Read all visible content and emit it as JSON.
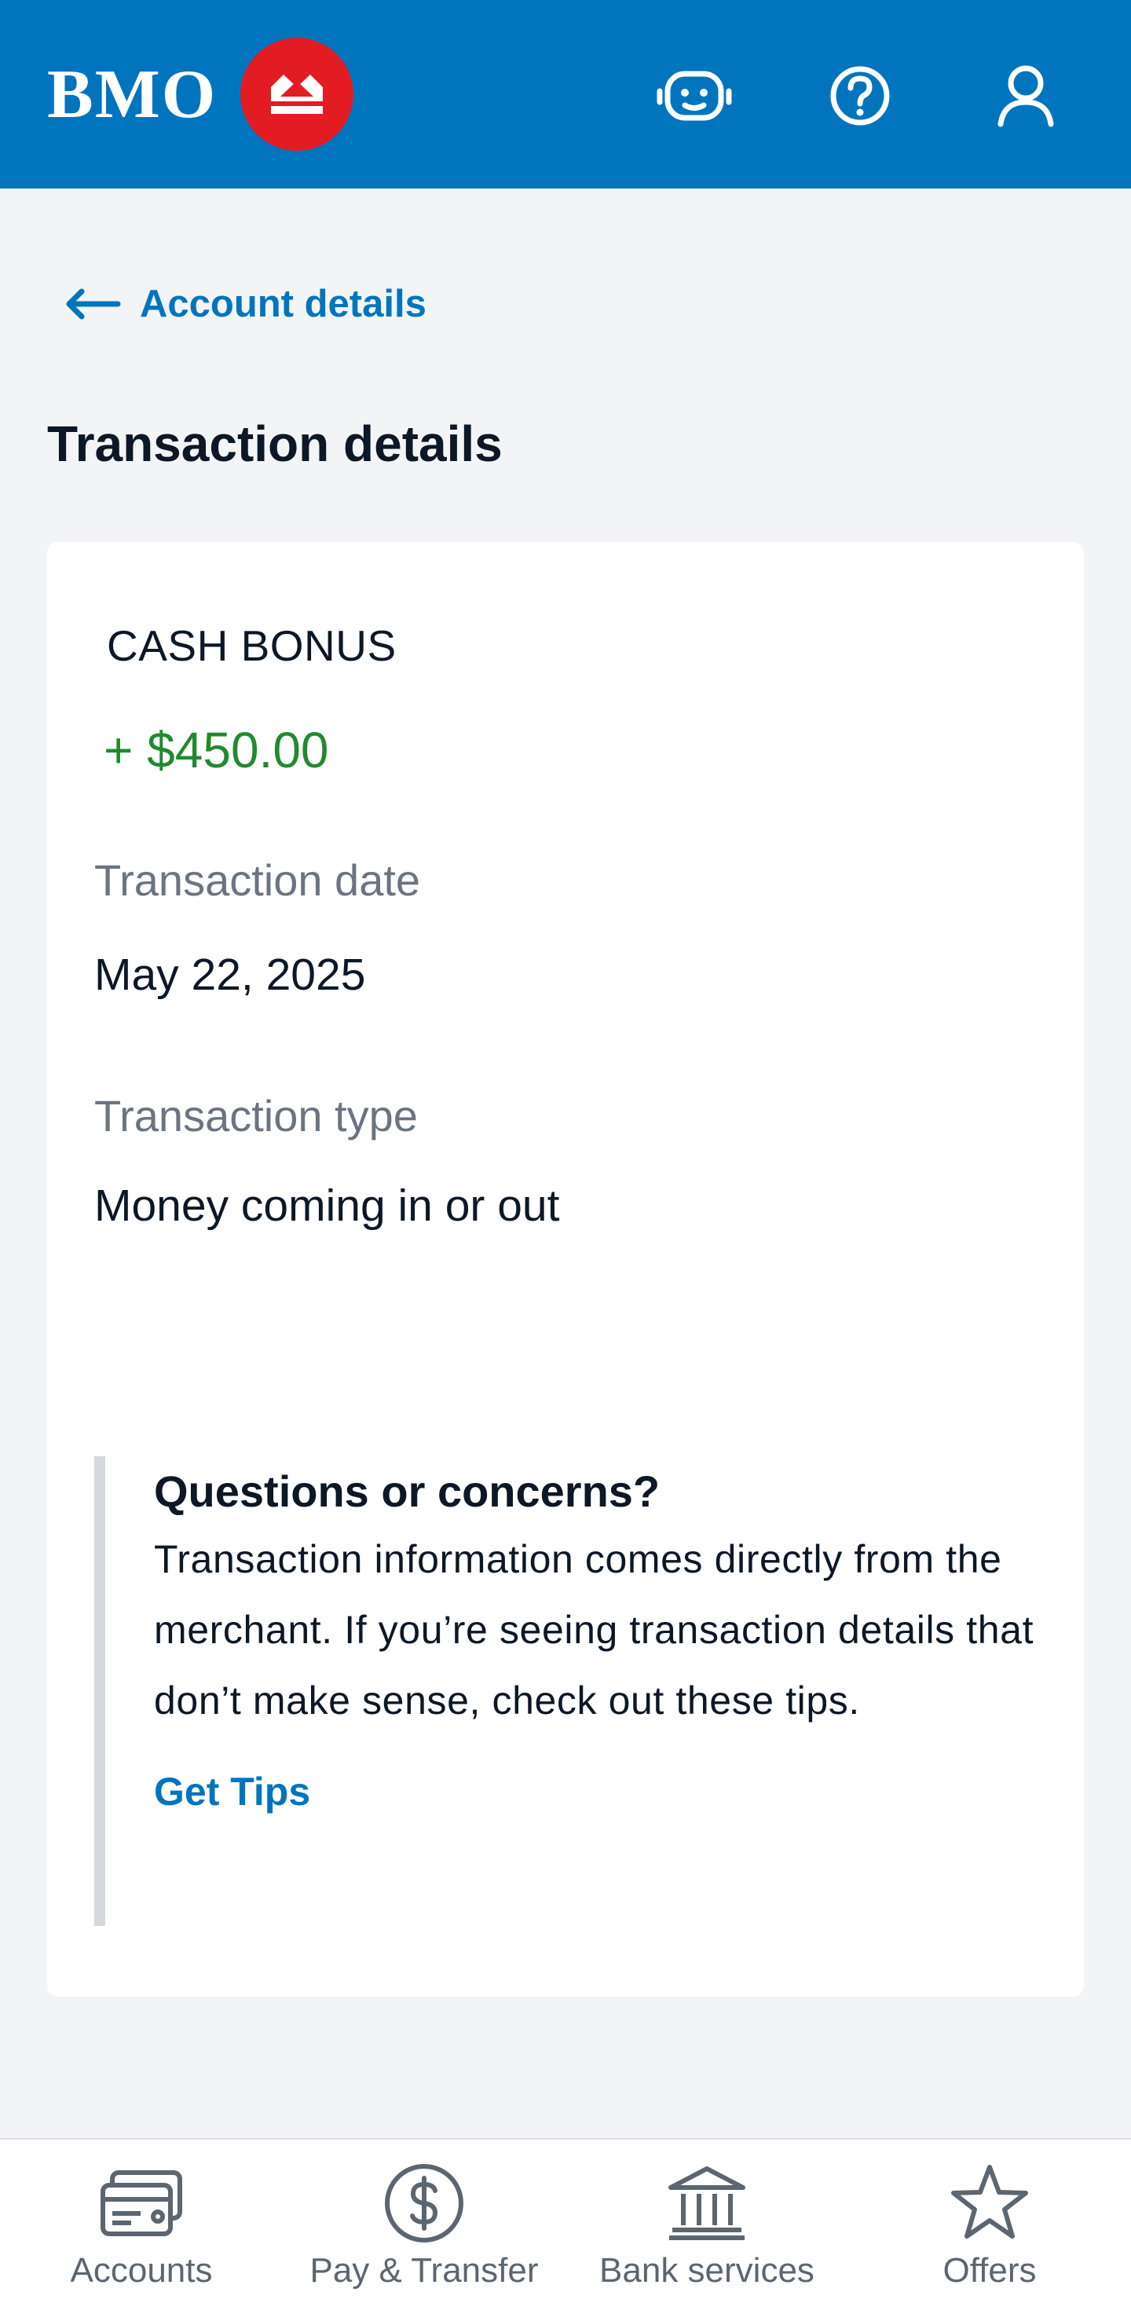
{
  "header": {
    "brand": "BMO",
    "icons": [
      "assistant-bot-icon",
      "help-icon",
      "profile-icon"
    ]
  },
  "nav": {
    "back_label": "Account details"
  },
  "page": {
    "title": "Transaction details"
  },
  "transaction": {
    "merchant": "CASH BONUS",
    "amount": "+ $450.00",
    "date_label": "Transaction date",
    "date_value": "May 22, 2025",
    "type_label": "Transaction type",
    "type_value": "Money coming in or out"
  },
  "concerns": {
    "title": "Questions or concerns?",
    "body": "Transaction information comes directly from the merchant. If you’re seeing transaction details that don’t make sense, check out these tips.",
    "link": "Get Tips"
  },
  "bottom_nav": [
    {
      "label": "Accounts",
      "icon": "accounts-card-icon"
    },
    {
      "label": "Pay & Transfer",
      "icon": "dollar-circle-icon"
    },
    {
      "label": "Bank services",
      "icon": "bank-building-icon"
    },
    {
      "label": "Offers",
      "icon": "star-icon"
    }
  ],
  "colors": {
    "brand_blue": "#0075be",
    "brand_red": "#e31b23",
    "positive_green": "#218a2f"
  }
}
